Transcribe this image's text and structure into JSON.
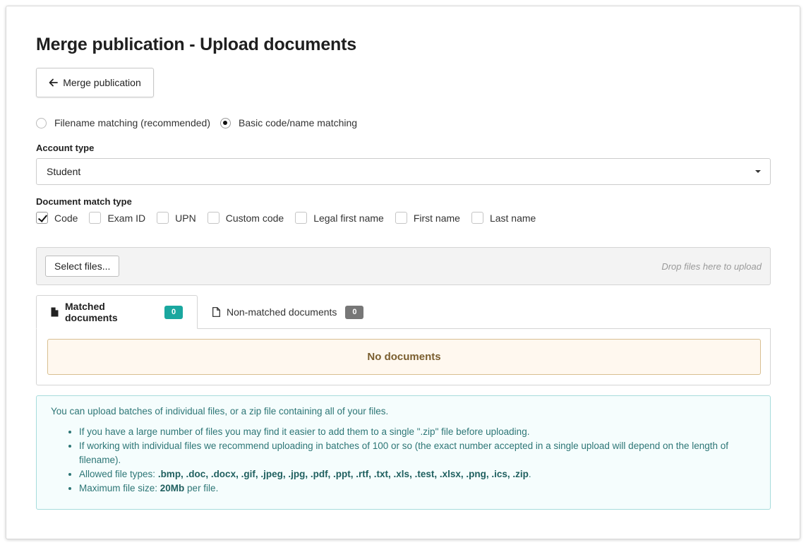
{
  "page": {
    "title": "Merge publication - Upload documents",
    "back_button_label": "Merge publication"
  },
  "matching_mode": {
    "options": [
      {
        "label": "Filename matching (recommended)",
        "selected": false
      },
      {
        "label": "Basic code/name matching",
        "selected": true
      }
    ]
  },
  "account_type": {
    "label": "Account type",
    "value": "Student"
  },
  "document_match_type": {
    "label": "Document match type",
    "options": [
      {
        "label": "Code",
        "checked": true
      },
      {
        "label": "Exam ID",
        "checked": false
      },
      {
        "label": "UPN",
        "checked": false
      },
      {
        "label": "Custom code",
        "checked": false
      },
      {
        "label": "Legal first name",
        "checked": false
      },
      {
        "label": "First name",
        "checked": false
      },
      {
        "label": "Last name",
        "checked": false
      }
    ]
  },
  "upload": {
    "select_files_label": "Select files...",
    "drop_hint": "Drop files here to upload"
  },
  "tabs": [
    {
      "label": "Matched documents",
      "count": "0",
      "badge_color": "#1aa79f",
      "icon": "file-solid-icon"
    },
    {
      "label": "Non-matched documents",
      "count": "0",
      "badge_color": "#777777",
      "icon": "file-outline-icon"
    }
  ],
  "empty_state": "No documents",
  "info": {
    "intro": "You can upload batches of individual files, or a zip file containing all of your files.",
    "bullet_1": "If you have a large number of files you may find it easier to add them to a single \".zip\" file before uploading.",
    "bullet_2": "If working with individual files we recommend uploading in batches of 100 or so (the exact number accepted in a single upload will depend on the length of filename).",
    "allowed_prefix": "Allowed file types: ",
    "allowed_types": ".bmp, .doc, .docx, .gif, .jpeg, .jpg, .pdf, .ppt, .rtf, .txt, .xls, .test, .xlsx, .png, .ics, .zip",
    "allowed_suffix": ".",
    "max_prefix": "Maximum file size: ",
    "max_size": "20Mb",
    "max_suffix": " per file."
  }
}
